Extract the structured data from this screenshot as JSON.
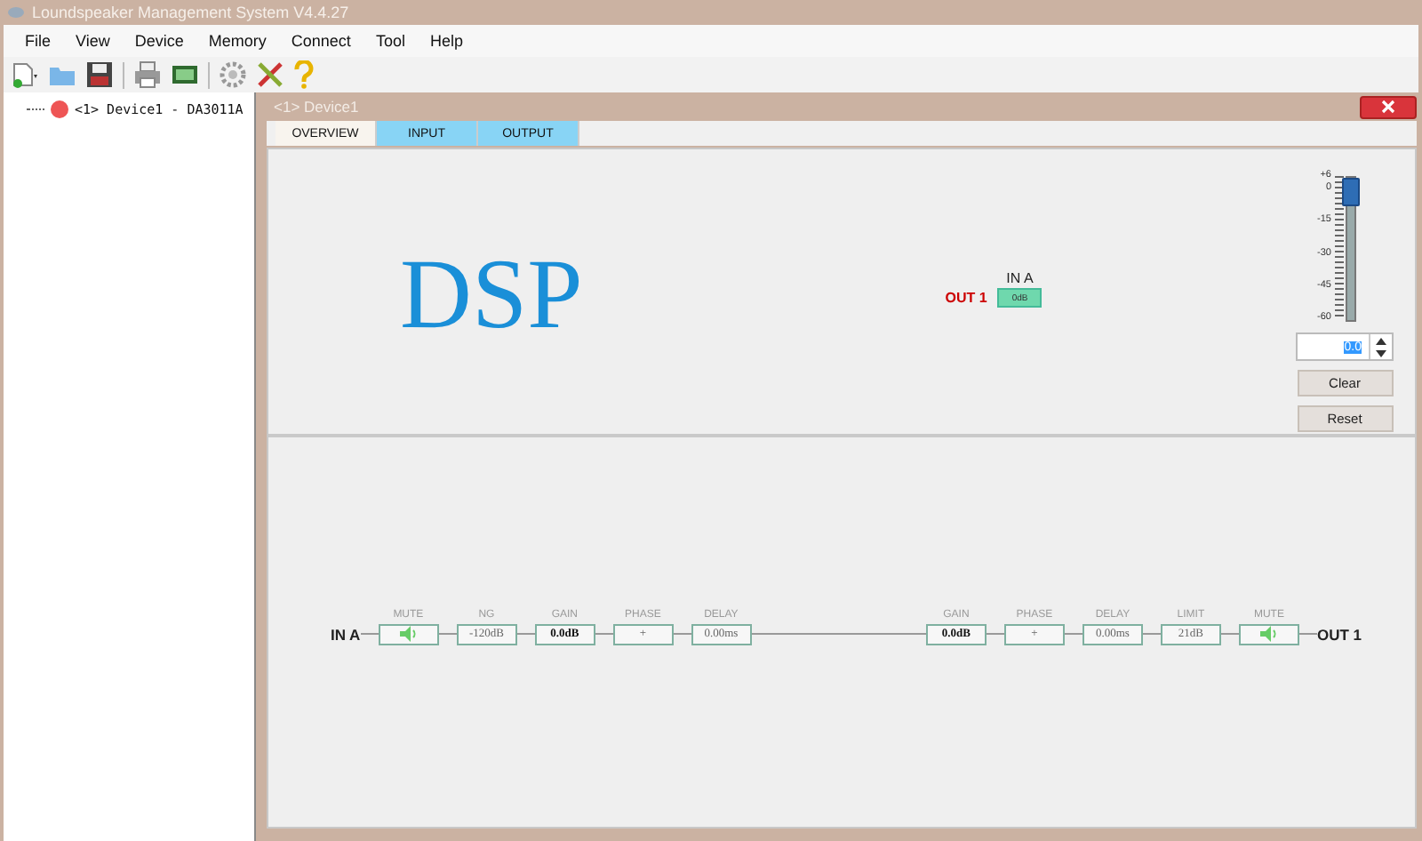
{
  "window": {
    "title": "Loundspeaker Management System V4.4.27"
  },
  "menu": [
    "File",
    "View",
    "Device",
    "Memory",
    "Connect",
    "Tool",
    "Help"
  ],
  "tree": [
    {
      "label": "<1> Device1 - DA3011A"
    }
  ],
  "device_window": {
    "title": "<1> Device1",
    "tabs": [
      {
        "label": "OVERVIEW",
        "selected": true
      },
      {
        "label": "INPUT",
        "selected": false
      },
      {
        "label": "OUTPUT",
        "selected": false
      }
    ],
    "logo": "DSP",
    "matrix": {
      "input": "IN A",
      "output": "OUT 1",
      "cell": "0dB"
    },
    "fader": {
      "scale": [
        "+6",
        "0",
        "-15",
        "-30",
        "-45",
        "-60"
      ],
      "level": 0.91,
      "value": "0.0",
      "buttons": [
        "Clear",
        "Reset"
      ]
    },
    "chain": {
      "input": "IN A",
      "output": "OUT 1",
      "input_blocks": [
        {
          "kind": "mute",
          "label": "MUTE"
        },
        {
          "kind": "value",
          "label": "NG",
          "value": "-120dB"
        },
        {
          "kind": "gain",
          "label": "GAIN",
          "value": "0.0dB"
        },
        {
          "kind": "value",
          "label": "PHASE",
          "value": "+"
        },
        {
          "kind": "value",
          "label": "DELAY",
          "value": "0.00ms"
        }
      ],
      "output_blocks": [
        {
          "kind": "gain",
          "label": "GAIN",
          "value": "0.0dB"
        },
        {
          "kind": "value",
          "label": "PHASE",
          "value": "+"
        },
        {
          "kind": "value",
          "label": "DELAY",
          "value": "0.00ms"
        },
        {
          "kind": "value",
          "label": "LIMIT",
          "value": "21dB"
        },
        {
          "kind": "mute",
          "label": "MUTE"
        }
      ]
    }
  }
}
